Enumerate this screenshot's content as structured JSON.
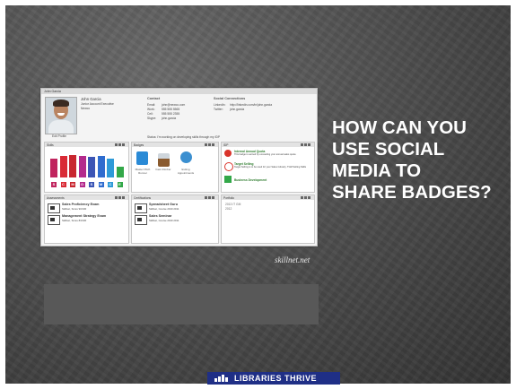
{
  "profile_window": {
    "title": "John Garcia",
    "name": "John Garcia",
    "role": "Junior Account Executive",
    "org": "Newco",
    "photo_caption": "Edit Profile",
    "contact_heading": "Contact",
    "contact": [
      {
        "label": "Email:",
        "value": "john@newco.com"
      },
      {
        "label": "Work:",
        "value": "555 555 5565"
      },
      {
        "label": "Cell:",
        "value": "555 555 2355"
      },
      {
        "label": "Skype:",
        "value": "john.garcia"
      }
    ],
    "social_heading": "Social Connections",
    "social": [
      {
        "label": "LinkedIn:",
        "value": "http://linkedin.com/in/john.garcia"
      },
      {
        "label": "Twitter:",
        "value": "john.garcia"
      }
    ],
    "status": "Status: I'm working on developing skills through my IDP",
    "skills_panel": {
      "title": "Skills",
      "bars": [
        {
          "value": 0.62,
          "color": "#c0245e"
        },
        {
          "value": 0.72,
          "color": "#d92a35"
        },
        {
          "value": 0.74,
          "color": "#c8262f"
        },
        {
          "value": 0.7,
          "color": "#b32a8c"
        },
        {
          "value": 0.68,
          "color": "#3b55b5"
        },
        {
          "value": 0.7,
          "color": "#2f6ccf"
        },
        {
          "value": 0.62,
          "color": "#2e9ad8"
        },
        {
          "value": 0.36,
          "color": "#33a849"
        }
      ],
      "letters": [
        "S",
        "C",
        "M",
        "O",
        "S",
        "M",
        "C",
        "E"
      ]
    },
    "badges_panel": {
      "title": "Badges",
      "items": [
        "Master Pitch Runner",
        "Fast Climber",
        "Exiting Appointments"
      ]
    },
    "idp_panel": {
      "title": "IDP",
      "items": [
        {
          "title": "Internal Annual Quota",
          "desc": "This badge is earned by exceeding your annual sales quota"
        },
        {
          "title": "Target Selling",
          "desc": "Target Selling is to be used for your Sales Industry. TGM Selling Skills"
        },
        {
          "title": "Business Development",
          "desc": ""
        }
      ]
    },
    "assessments_panel": {
      "title": "Assessments",
      "items": [
        {
          "title": "Sales Proficiency Exam",
          "meta": "Skillnet, Score 90/100"
        },
        {
          "title": "Management Strategy Exam",
          "meta": "Skillnet, Score 83/100"
        }
      ]
    },
    "certifications_panel": {
      "title": "Certifications",
      "items": [
        {
          "title": "Spreadsheet Guru",
          "meta": "Skillnet, Course 2010 2011"
        },
        {
          "title": "Sales Seminar",
          "meta": "Skillnet, Course 2010 2011"
        }
      ]
    },
    "portfolio_panel": {
      "title": "Portfolio",
      "items": [
        "2013 IT GM",
        "2012"
      ]
    }
  },
  "slide": {
    "heading_lines": [
      "HOW CAN YOU",
      "USE SOCIAL",
      "MEDIA TO",
      "SHARE BADGES?"
    ],
    "source": "skillnet.net",
    "footer_logo": "LIBRARIES THRIVE"
  }
}
